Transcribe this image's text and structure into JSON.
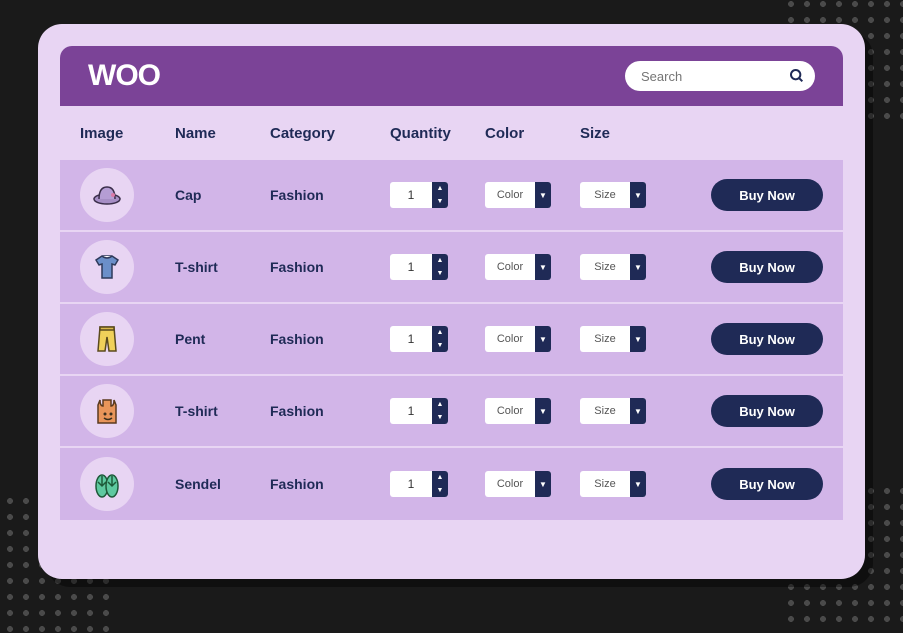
{
  "header": {
    "logo": "WOO",
    "search_placeholder": "Search"
  },
  "columns": {
    "image": "Image",
    "name": "Name",
    "category": "Category",
    "quantity": "Quantity",
    "color": "Color",
    "size": "Size"
  },
  "labels": {
    "color_select": "Color",
    "size_select": "Size",
    "buy": "Buy Now"
  },
  "products": [
    {
      "name": "Cap",
      "category": "Fashion",
      "quantity": 1,
      "icon": "cap"
    },
    {
      "name": "T-shirt",
      "category": "Fashion",
      "quantity": 1,
      "icon": "tshirt"
    },
    {
      "name": "Pent",
      "category": "Fashion",
      "quantity": 1,
      "icon": "pent"
    },
    {
      "name": "T-shirt",
      "category": "Fashion",
      "quantity": 1,
      "icon": "tank"
    },
    {
      "name": "Sendel",
      "category": "Fashion",
      "quantity": 1,
      "icon": "sendel"
    }
  ]
}
